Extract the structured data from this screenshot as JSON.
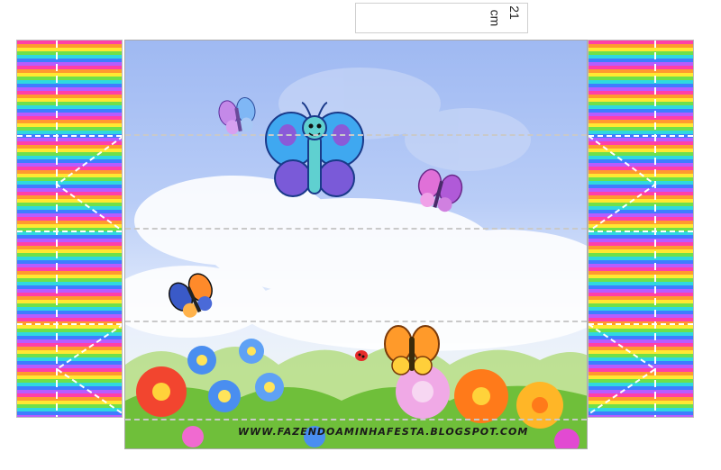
{
  "label": {
    "value": "21",
    "unit": "cm"
  },
  "footer": {
    "site_url": "WWW.FAZENDOAMINHAFESTA.BLOGSPOT.COM"
  },
  "colors": {
    "sky_top": "#9fb9f2",
    "stripe_pink": "#ff3fa8",
    "stripe_green": "#6fe04a",
    "butterfly_blue": "#3fa8f0"
  },
  "icons": [
    "butterfly-icon",
    "flower-icon",
    "ladybug-icon"
  ]
}
